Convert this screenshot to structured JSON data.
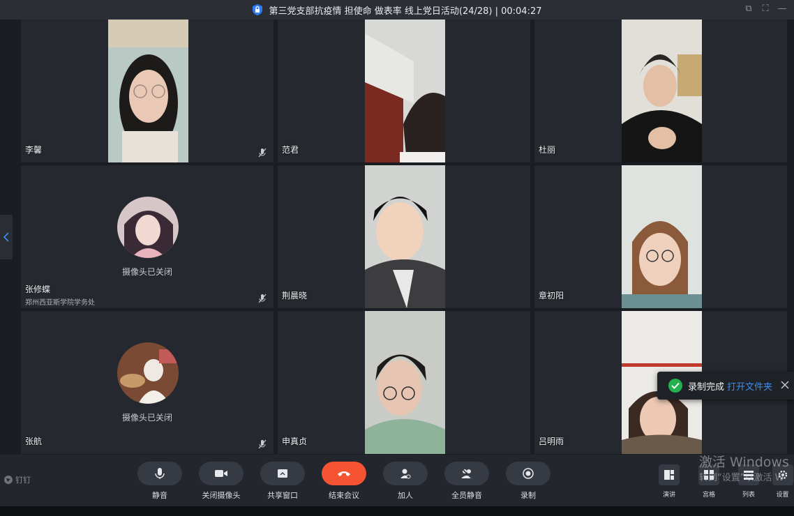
{
  "window": {
    "title": "第三党支部抗疫情 担使命 做表率 线上党日活动(24/28) | 00:04:27"
  },
  "participants": [
    {
      "name": "李馨",
      "camera": "on",
      "muted": true
    },
    {
      "name": "范君",
      "camera": "on",
      "muted": false
    },
    {
      "name": "杜丽",
      "camera": "on",
      "muted": false
    },
    {
      "name": "张修蝶",
      "org": "郑州西亚斯学院学务处",
      "camera": "off",
      "camera_off_text": "摄像头已关闭",
      "muted": true
    },
    {
      "name": "荆晨晓",
      "camera": "on",
      "muted": false
    },
    {
      "name": "章初阳",
      "camera": "on",
      "muted": false
    },
    {
      "name": "张航",
      "camera": "off",
      "camera_off_text": "摄像头已关闭",
      "muted": true
    },
    {
      "name": "申真贞",
      "camera": "on",
      "muted": false
    },
    {
      "name": "吕明雨",
      "camera": "on",
      "muted": false
    }
  ],
  "toolbar": {
    "brand": "钉钉",
    "buttons": [
      {
        "label": "静音",
        "icon": "microphone-icon"
      },
      {
        "label": "关闭摄像头",
        "icon": "camera-icon"
      },
      {
        "label": "共享窗口",
        "icon": "share-screen-icon"
      },
      {
        "label": "结束会议",
        "icon": "hang-up-icon"
      },
      {
        "label": "加人",
        "icon": "add-person-icon"
      },
      {
        "label": "全员静音",
        "icon": "mute-all-icon"
      },
      {
        "label": "录制",
        "icon": "record-icon"
      }
    ],
    "layout_buttons": [
      {
        "label": "演讲",
        "icon": "speaker-layout-icon"
      },
      {
        "label": "宫格",
        "icon": "grid-layout-icon"
      },
      {
        "label": "列表",
        "icon": "list-layout-icon"
      },
      {
        "label": "设置",
        "icon": "settings-icon"
      }
    ]
  },
  "toast": {
    "message": "录制完成",
    "link": "打开文件夹"
  },
  "watermark": {
    "line1": "激活 Windows",
    "line2": "转到“设置”以激活 W"
  },
  "colors": {
    "end_call": "#f55332",
    "link": "#3a8ef5",
    "success": "#22b14c",
    "background": "#1a1d22",
    "tile": "#25282e"
  }
}
